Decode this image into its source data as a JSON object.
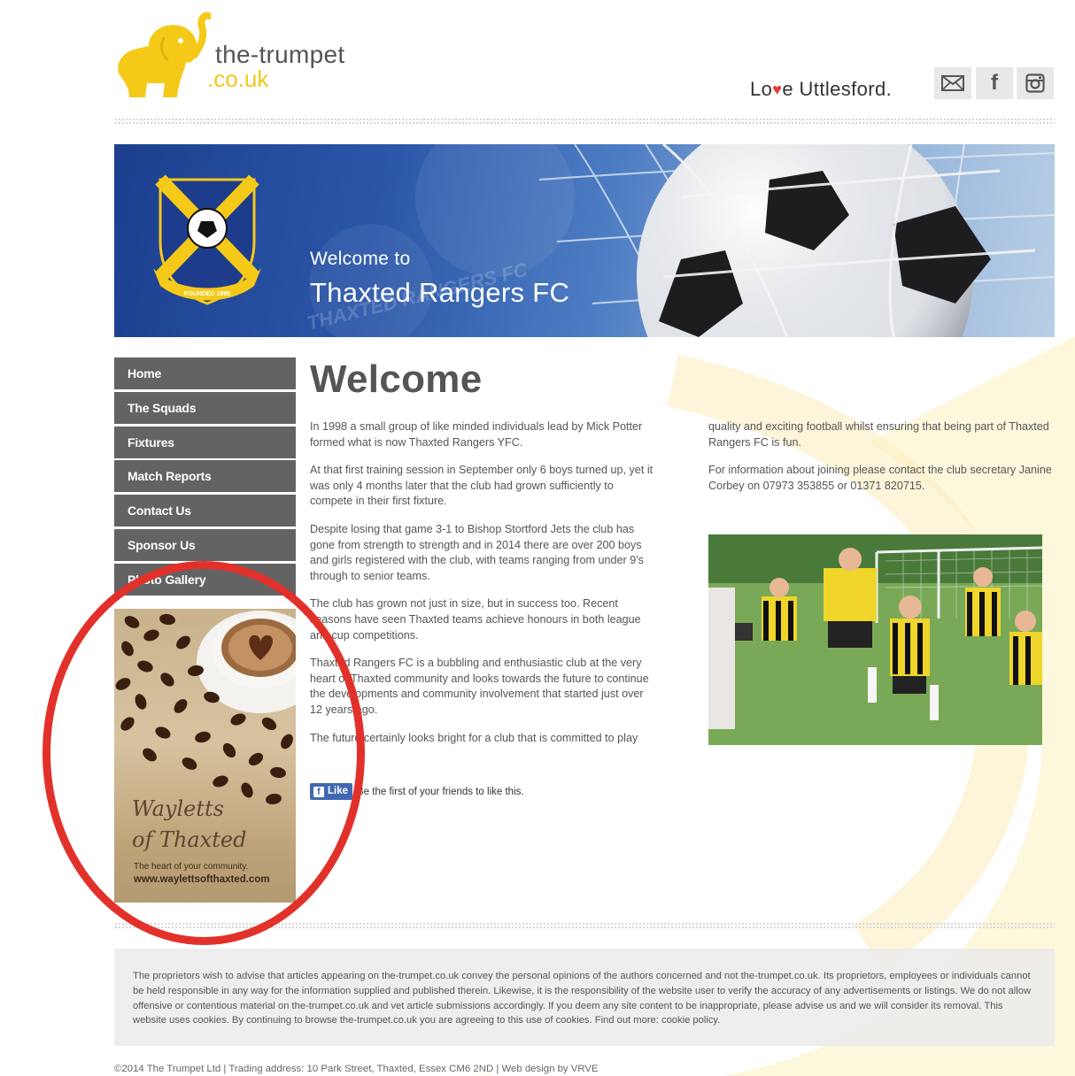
{
  "header": {
    "logo_main": "the-trumpet",
    "logo_sub": ".co.uk",
    "tagline_before": "Lo",
    "tagline_heart": "♥",
    "tagline_after": "e Uttlesford.",
    "social": [
      {
        "name": "mail",
        "icon": "envelope-icon"
      },
      {
        "name": "facebook",
        "label": "f",
        "icon": "facebook-icon"
      },
      {
        "name": "instagram",
        "icon": "instagram-icon"
      }
    ],
    "logo_colors": {
      "elephant": "#f5c918",
      "text": "#555555"
    }
  },
  "banner": {
    "welcome": "Welcome to",
    "title": "Thaxted Rangers FC",
    "crest_text": "THAXTED RANGERS FC",
    "crest_founded": "FOUNDED 1998",
    "watermark_text": "THAXTED RANGERS FC"
  },
  "nav": {
    "items": [
      "Home",
      "The Squads",
      "Fixtures",
      "Match Reports",
      "Contact Us",
      "Sponsor Us",
      "Photo Gallery"
    ]
  },
  "ad": {
    "line1": "Wayletts",
    "line2": "of Thaxted",
    "tagline": "The heart of your community.",
    "url": "www.waylettsofthaxted.com"
  },
  "main": {
    "title": "Welcome",
    "col1": [
      "In 1998 a small group of like minded individuals lead by Mick Potter formed what is now Thaxted Rangers YFC.",
      "At that first training session in September only 6 boys turned up, yet it was only 4 months later that the club had grown sufficiently to compete in their first fixture.",
      "Despite losing that game 3-1 to Bishop Stortford Jets the club has gone from strength to strength and in 2014 there are over 200 boys and girls registered with the club, with teams ranging from under 9's through to senior teams.",
      "The club has grown not just in size, but in success too. Recent seasons have seen Thaxted teams achieve honours in both league and cup competitions.",
      "Thaxted Rangers FC is a bubbling and enthusiastic club at the very heart of Thaxted community and looks towards the future to continue the developments and community involvement that started just over 12 years ago.",
      "The future certainly looks bright for a club that is committed to play"
    ],
    "col2": [
      "quality and exciting football whilst ensuring that being part of Thaxted Rangers FC is fun.",
      "For information about joining please contact the club secretary Janine Corbey on 07973 353855 or 01371 820715."
    ],
    "fb_like_label": "Like",
    "fb_like_icon": "f",
    "fb_text": "Be the first of your friends to like this."
  },
  "footer": {
    "disclaimer": "The proprietors wish to advise that articles appearing on the-trumpet.co.uk convey the personal opinions of the authors concerned and not the-trumpet.co.uk. Its proprietors, employees or individuals cannot be held responsible in any way for the information supplied and published therein. Likewise, it is the responsibility of the website user to verify the accuracy of any advertisements or listings. We do not allow offensive or contentious material on the-trumpet.co.uk and vet article submissions accordingly. If you deem any site content to be inappropriate, please advise us and we will consider its removal. This website uses cookies. By continuing to browse the-trumpet.co.uk you are agreeing to this use of cookies. Find out more: cookie policy.",
    "copyright": "©2014 The Trumpet Ltd | Trading address: 10 Park Street, Thaxted, Essex CM6 2ND | Web design by VRVE"
  },
  "annotation": {
    "color": "#e2312b"
  }
}
